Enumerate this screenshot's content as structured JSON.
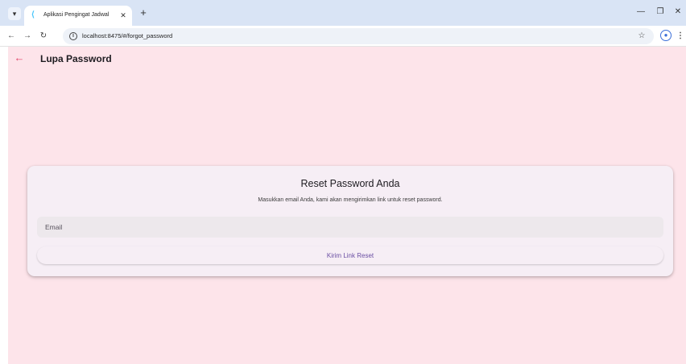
{
  "browser": {
    "tab_title": "Aplikasi Pengingat Jadwal",
    "url": "localhost:8475/#/forgot_password",
    "icons": {
      "tab_menu": "chevron-down-icon",
      "favicon": "flutter-icon",
      "tab_close": "close-icon",
      "new_tab": "plus-icon",
      "minimize": "minimize-icon",
      "restore": "restore-icon",
      "close_window": "close-icon",
      "back": "arrow-left-icon",
      "forward": "arrow-right-icon",
      "reload": "reload-icon",
      "site_info": "info-icon",
      "bookmark": "star-icon",
      "profile": "profile-icon",
      "menu": "kebab-icon"
    }
  },
  "appbar": {
    "title": "Lupa Password",
    "back_icon": "arrow-left-icon",
    "back_icon_color": "#e2456a"
  },
  "card": {
    "title": "Reset Password Anda",
    "description": "Masukkan email Anda, kami akan mengirimkan link untuk reset password.",
    "email_placeholder": "Email",
    "email_value": "",
    "submit_label": "Kirim Link Reset"
  },
  "colors": {
    "page_background": "#fde4ea",
    "card_background": "#f6eef5",
    "input_background": "#ede8ec",
    "button_text": "#6a4fa3",
    "browser_frame": "#d9e4f5"
  }
}
